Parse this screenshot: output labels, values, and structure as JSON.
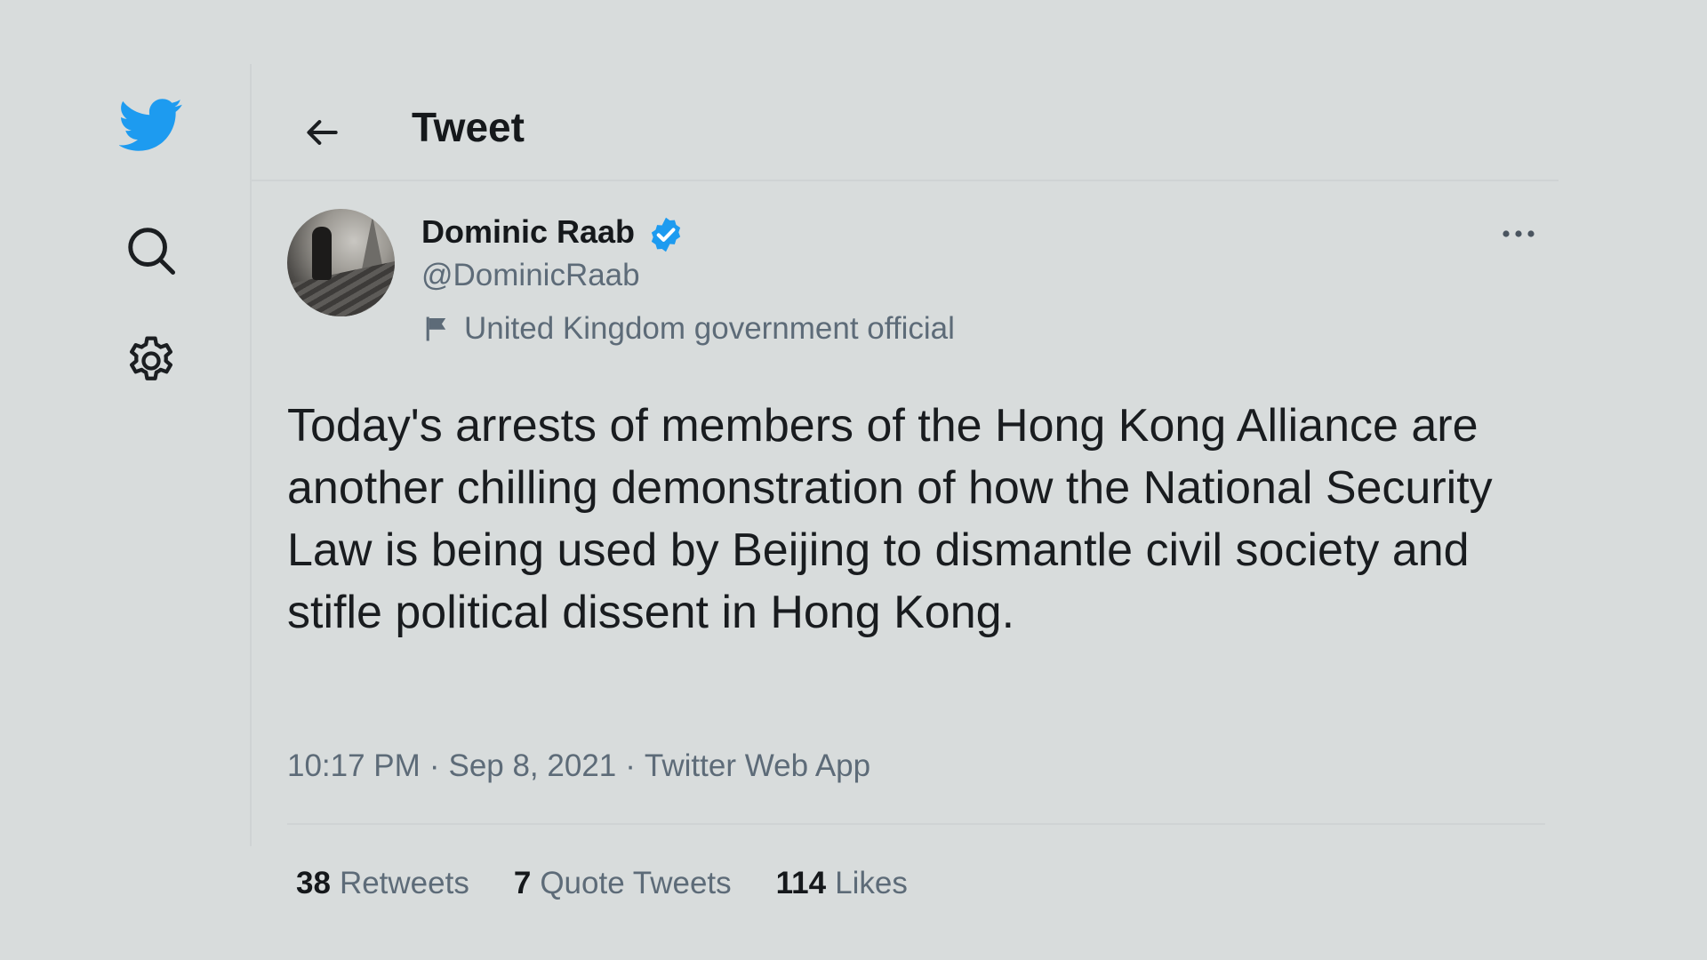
{
  "header": {
    "title": "Tweet",
    "back_icon": "arrow-left-icon"
  },
  "nav": {
    "items": [
      {
        "icon": "twitter-bird-icon",
        "color": "#1d9bf0"
      },
      {
        "icon": "search-icon"
      },
      {
        "icon": "gear-icon"
      }
    ]
  },
  "tweet": {
    "author": {
      "name": "Dominic Raab",
      "handle": "@DominicRaab",
      "verified": true,
      "verified_color": "#1d9bf0",
      "label": "United Kingdom government official"
    },
    "text": "Today's arrests of members of the Hong Kong Alliance are another chilling demonstration of how the National Security Law is being used by Beijing to dismantle civil society and stifle political dissent in Hong Kong.",
    "time": "10:17 PM",
    "separator": "·",
    "date": "Sep 8, 2021",
    "source": "Twitter Web App",
    "stats": {
      "retweets_count": "38",
      "retweets_label": "Retweets",
      "quotes_count": "7",
      "quotes_label": "Quote Tweets",
      "likes_count": "114",
      "likes_label": "Likes"
    },
    "more_icon": "ellipsis-icon"
  }
}
